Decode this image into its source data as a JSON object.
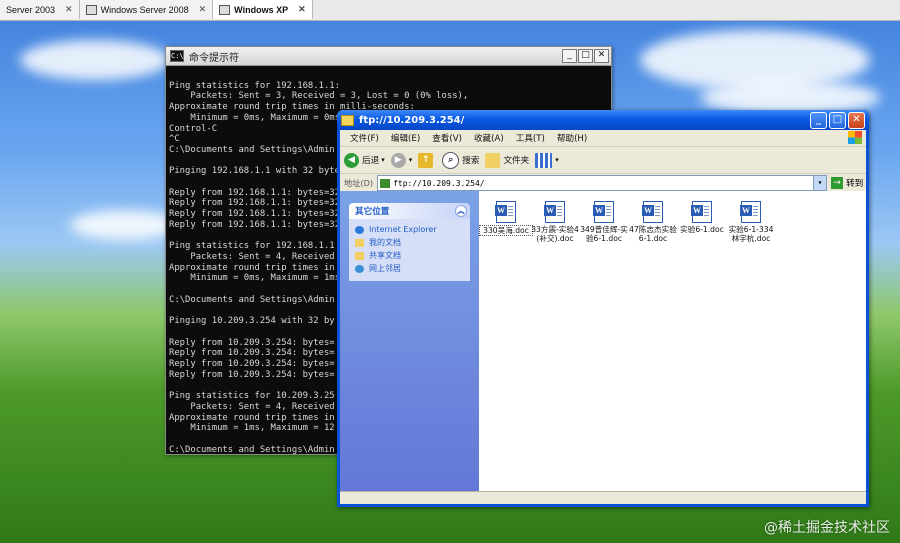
{
  "vm_tabs": [
    {
      "label": "Server 2003"
    },
    {
      "label": "Windows Server 2008"
    },
    {
      "label": "Windows XP"
    }
  ],
  "cmd": {
    "title": "命令提示符",
    "lines": [
      "",
      "Ping statistics for 192.168.1.1:",
      "    Packets: Sent = 3, Received = 3, Lost = 0 (0% loss),",
      "Approximate round trip times in milli-seconds:",
      "    Minimum = 0ms, Maximum = 0ms",
      "Control-C",
      "^C",
      "C:\\Documents and Settings\\Admin",
      "",
      "Pinging 192.168.1.1 with 32 byte",
      "",
      "Reply from 192.168.1.1: bytes=32",
      "Reply from 192.168.1.1: bytes=32",
      "Reply from 192.168.1.1: bytes=32",
      "Reply from 192.168.1.1: bytes=32",
      "",
      "Ping statistics for 192.168.1.1",
      "    Packets: Sent = 4, Received",
      "Approximate round trip times in",
      "    Minimum = 0ms, Maximum = 1ms",
      "",
      "C:\\Documents and Settings\\Admin",
      "",
      "Pinging 10.209.3.254 with 32 by",
      "",
      "Reply from 10.209.3.254: bytes=",
      "Reply from 10.209.3.254: bytes=",
      "Reply from 10.209.3.254: bytes=",
      "Reply from 10.209.3.254: bytes=",
      "",
      "Ping statistics for 10.209.3.25",
      "    Packets: Sent = 4, Received",
      "Approximate round trip times in",
      "    Minimum = 1ms, Maximum = 12",
      "",
      "C:\\Documents and Settings\\Admin"
    ]
  },
  "explorer": {
    "title": "ftp://10.209.3.254/",
    "menus": [
      "文件(F)",
      "编辑(E)",
      "查看(V)",
      "收藏(A)",
      "工具(T)",
      "帮助(H)"
    ],
    "toolbar": {
      "back": "后退",
      "search": "搜索",
      "folders": "文件夹"
    },
    "address_label": "地址(D)",
    "address_value": "ftp://10.209.3.254/",
    "go_label": "转到",
    "panel_title": "其它位置",
    "panel_links": [
      "Internet Explorer",
      "我的文档",
      "共享文档",
      "网上邻居"
    ],
    "files": [
      "330吴海.doc",
      "33方震-实验4(补交).doc",
      "349曾佳辉-实验6-1.doc",
      "47陈志杰实验6-1.doc",
      "实验6-1.doc",
      "实验6-1-334林宇杭.doc"
    ]
  },
  "watermark": "@稀土掘金技术社区"
}
